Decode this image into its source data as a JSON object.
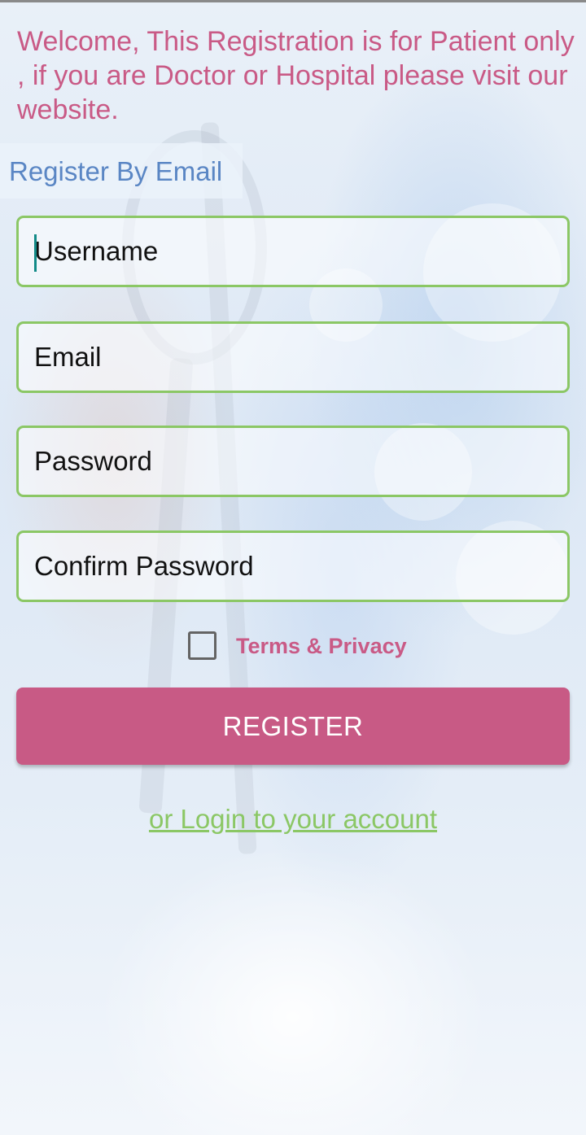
{
  "header": {
    "welcome_text": "Welcome, This Registration is for Patient only , if you are Doctor or Hospital please visit our website.",
    "section_title": "Register By Email"
  },
  "form": {
    "username": {
      "placeholder": "Username",
      "value": ""
    },
    "email": {
      "placeholder": "Email",
      "value": ""
    },
    "password": {
      "placeholder": "Password",
      "value": ""
    },
    "confirm_password": {
      "placeholder": "Confirm Password",
      "value": ""
    },
    "terms_label": "Terms & Privacy",
    "terms_checked": false,
    "register_label": "REGISTER",
    "login_link": "or Login to your account"
  },
  "colors": {
    "accent_pink": "#c85a85",
    "field_border_green": "#8bc765",
    "section_blue": "#5a86c4",
    "caret_teal": "#128a87"
  }
}
